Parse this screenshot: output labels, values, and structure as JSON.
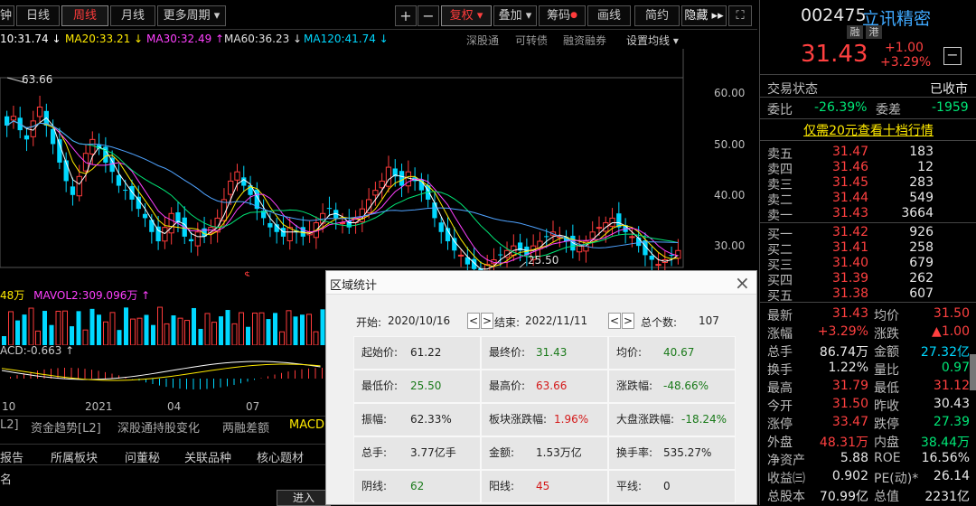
{
  "tabs": [
    {
      "label": "钟",
      "x": 0
    },
    {
      "label": "日线"
    },
    {
      "label": "周线",
      "active": true
    },
    {
      "label": "月线"
    },
    {
      "label": "更多周期 ▾"
    }
  ],
  "toolbar": {
    "plus": "+",
    "minus": "−",
    "fuquan": "复权",
    "fuquan_arrow": "▾",
    "diejia": "叠加 ▾",
    "chouma": "筹码",
    "huaxian": "画线",
    "jianyue": "简约",
    "yincang": "隐藏 ▸▸",
    "expand": "⛶"
  },
  "ma_line": {
    "ma10": "10:31.74 ↓",
    "ma20": "MA20:33.21 ↓",
    "ma30": "MA30:32.49 ↑",
    "ma60": "MA60:36.23 ↓",
    "ma120": "MA120:41.74 ↓",
    "links": [
      "深股通",
      "可转债",
      "融资融券",
      "设置均线 ▾"
    ]
  },
  "price_axis": [
    "60.00",
    "50.00",
    "40.00",
    "30.00"
  ],
  "annotations": {
    "high": "63.66",
    "low": "25.50"
  },
  "vol_line": {
    "left": "48万",
    "mavol2": "MAVOL2:309.096万 ↑"
  },
  "macd_line": "ACD:-0.663 ↑",
  "date_axis": [
    "10",
    "2021",
    "04",
    "07"
  ],
  "bottom_tabs": [
    "L2]",
    "资金趋势[L2]",
    "深股通持股变化",
    "两融差额",
    "MACD"
  ],
  "bottom_tabs2": [
    "报告",
    "所属板块",
    "问董秘",
    "关联品种",
    "核心题材"
  ],
  "bottom_name": "名",
  "bottom_enter": "进入",
  "stock": {
    "code": "002475",
    "name": "立讯精密",
    "tags": [
      "融",
      "港"
    ],
    "price": "31.43",
    "change": "+1.00",
    "pct": "+3.29%"
  },
  "trade_status": {
    "label": "交易状态",
    "value": "已收市"
  },
  "weibi": {
    "label": "委比",
    "value": "-26.39%",
    "label2": "委差",
    "value2": "-1959"
  },
  "promo": "仅需20元查看十档行情",
  "asks": [
    {
      "label": "卖五",
      "price": "31.47",
      "vol": "183"
    },
    {
      "label": "卖四",
      "price": "31.46",
      "vol": "12"
    },
    {
      "label": "卖三",
      "price": "31.45",
      "vol": "283"
    },
    {
      "label": "卖二",
      "price": "31.44",
      "vol": "549"
    },
    {
      "label": "卖一",
      "price": "31.43",
      "vol": "3664"
    }
  ],
  "bids": [
    {
      "label": "买一",
      "price": "31.42",
      "vol": "926"
    },
    {
      "label": "买二",
      "price": "31.41",
      "vol": "258"
    },
    {
      "label": "买三",
      "price": "31.40",
      "vol": "679"
    },
    {
      "label": "买四",
      "price": "31.39",
      "vol": "262"
    },
    {
      "label": "买五",
      "price": "31.38",
      "vol": "607"
    }
  ],
  "stats": [
    {
      "l1": "最新",
      "v1": "31.43",
      "c1": "red",
      "l2": "均价",
      "v2": "31.50",
      "c2": "red"
    },
    {
      "l1": "涨幅",
      "v1": "+3.29%",
      "c1": "red",
      "l2": "涨跌",
      "v2": "▲1.00",
      "c2": "red"
    },
    {
      "l1": "总手",
      "v1": "86.74万",
      "c1": "wht",
      "l2": "金额",
      "v2": "27.32亿",
      "c2": "cyan"
    },
    {
      "l1": "换手",
      "v1": "1.22%",
      "c1": "wht",
      "l2": "量比",
      "v2": "0.97",
      "c2": "grn"
    },
    {
      "l1": "最高",
      "v1": "31.79",
      "c1": "red",
      "l2": "最低",
      "v2": "31.12",
      "c2": "red"
    },
    {
      "l1": "今开",
      "v1": "31.50",
      "c1": "red",
      "l2": "昨收",
      "v2": "30.43",
      "c2": "wht"
    },
    {
      "l1": "涨停",
      "v1": "33.47",
      "c1": "red",
      "l2": "跌停",
      "v2": "27.39",
      "c2": "grn"
    },
    {
      "l1": "外盘",
      "v1": "48.31万",
      "c1": "red",
      "l2": "内盘",
      "v2": "38.44万",
      "c2": "grn"
    },
    {
      "l1": "净资产",
      "v1": "5.88",
      "c1": "wht",
      "l2": "ROE",
      "v2": "16.56%",
      "c2": "wht"
    },
    {
      "l1": "收益㈢",
      "v1": "0.902",
      "c1": "wht",
      "l2": "PE(动)*",
      "v2": "26.14",
      "c2": "wht"
    },
    {
      "l1": "总股本",
      "v1": "70.99亿",
      "c1": "wht",
      "l2": "总值",
      "v2": "2231亿",
      "c2": "wht"
    }
  ],
  "dialog": {
    "title": "区域统计",
    "close": "×",
    "start_label": "开始:",
    "start": "2020/10/16",
    "end_label": "结束:",
    "end": "2022/11/11",
    "count_label": "总个数:",
    "count": "107",
    "prev": "<",
    "next": ">",
    "rows": [
      [
        {
          "l": "起始价:",
          "v": "61.22",
          "c": "#222"
        },
        {
          "l": "最终价:",
          "v": "31.43",
          "c": "#1a7a1a"
        },
        {
          "l": "均价:",
          "v": "40.67",
          "c": "#1a7a1a"
        }
      ],
      [
        {
          "l": "最低价:",
          "v": "25.50",
          "c": "#1a7a1a"
        },
        {
          "l": "最高价:",
          "v": "63.66",
          "c": "#d41a1a"
        },
        {
          "l": "涨跌幅:",
          "v": "-48.66%",
          "c": "#1a7a1a"
        }
      ],
      [
        {
          "l": "振幅:",
          "v": "62.33%",
          "c": "#222"
        },
        {
          "l": "板块涨跌幅:",
          "v": "1.96%",
          "c": "#d41a1a"
        },
        {
          "l": "大盘涨跌幅:",
          "v": "-18.24%",
          "c": "#1a7a1a"
        }
      ],
      [
        {
          "l": "总手:",
          "v": "3.77亿手",
          "c": "#222"
        },
        {
          "l": "金额:",
          "v": "1.53万亿",
          "c": "#222"
        },
        {
          "l": "换手率:",
          "v": "535.27%",
          "c": "#222"
        }
      ],
      [
        {
          "l": "阴线:",
          "v": "62",
          "c": "#1a7a1a"
        },
        {
          "l": "阳线:",
          "v": "45",
          "c": "#d41a1a"
        },
        {
          "l": "平线:",
          "v": "0",
          "c": "#222"
        }
      ]
    ]
  },
  "colors": {
    "up": "#ff3b3b",
    "down": "#00d8ff",
    "ma10": "#ffffff",
    "ma20": "#ffea00",
    "ma30": "#ff40ff",
    "ma60": "#00e676",
    "ma120": "#4fa3ff"
  }
}
